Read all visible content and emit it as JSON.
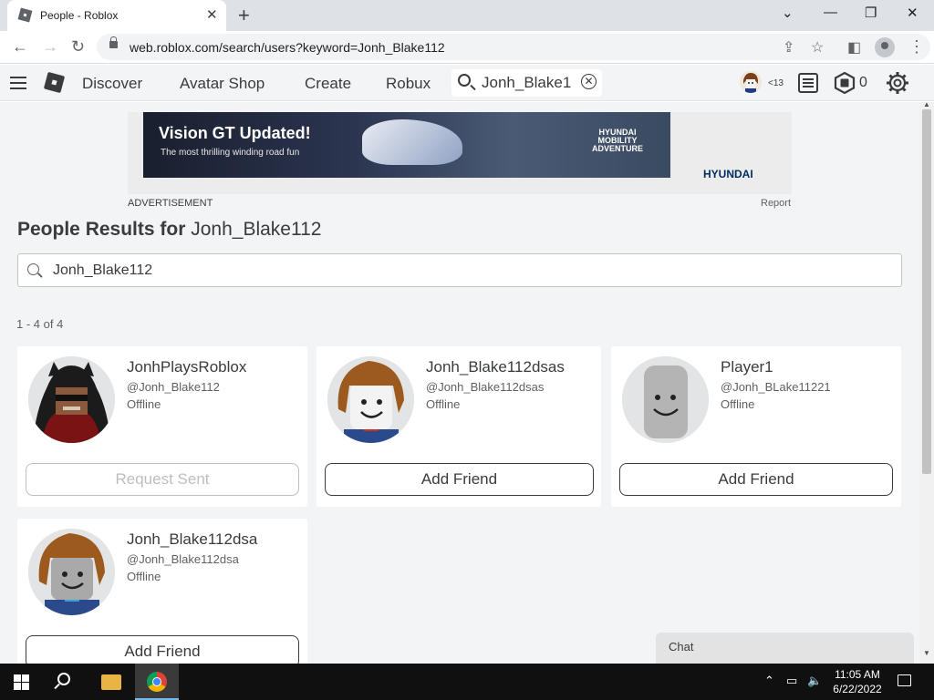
{
  "browser": {
    "tab_title": "People - Roblox",
    "tab_close": "✕",
    "new_tab": "+",
    "window_controls": {
      "minimize": "—",
      "restore": "❐",
      "close": "✕",
      "tab_search": "⌄"
    },
    "url": "web.roblox.com/search/users?keyword=Jonh_Blake112"
  },
  "header": {
    "nav": [
      "Discover",
      "Avatar Shop",
      "Create",
      "Robux"
    ],
    "search_value": "Jonh_Blake1",
    "age_badge": "<13",
    "robux": "0"
  },
  "ad": {
    "headline": "Vision GT Updated!",
    "subline": "The most thrilling winding road fun",
    "tag": "HYUNDAI MOBILITY ADVENTURE",
    "brand": "HYUNDAI",
    "label": "ADVERTISEMENT",
    "report": "Report"
  },
  "results": {
    "title_prefix": "People Results for",
    "keyword": "Jonh_Blake112",
    "search_value": "Jonh_Blake112",
    "count": "1 - 4 of 4",
    "users": [
      {
        "display_name": "JonhPlaysRoblox",
        "username": "@Jonh_Blake112",
        "status": "Offline",
        "button": "Request Sent"
      },
      {
        "display_name": "Jonh_Blake112dsas",
        "username": "@Jonh_Blake112dsas",
        "status": "Offline",
        "button": "Add Friend"
      },
      {
        "display_name": "Player1",
        "username": "@Jonh_BLake11221",
        "status": "Offline",
        "button": "Add Friend"
      },
      {
        "display_name": "Jonh_Blake112dsa",
        "username": "@Jonh_Blake112dsa",
        "status": "Offline",
        "button": "Add Friend"
      }
    ]
  },
  "chat": {
    "label": "Chat"
  },
  "taskbar": {
    "time": "11:05 AM",
    "date": "6/22/2022"
  }
}
